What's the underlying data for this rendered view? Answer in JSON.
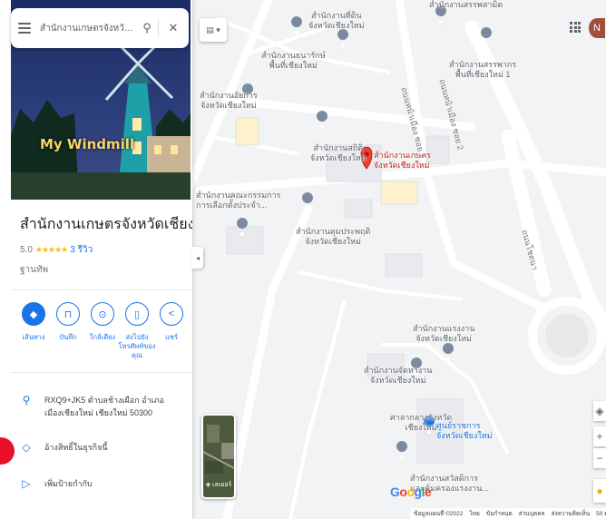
{
  "search": {
    "query": "สำนักงานเกษตรจังหวัดเชียงใหม่"
  },
  "photo": {
    "sign_text": "My Windmill"
  },
  "place": {
    "title": "สำนักงานเกษตรจังหวัดเชียงใหม่",
    "rating_value": "5.0",
    "stars": "★★★★★",
    "review_count": "3 รีวิว",
    "category": "ฐานทัพ"
  },
  "actions": [
    {
      "label": "เส้นทาง",
      "icon": "directions-icon"
    },
    {
      "label": "บันทึก",
      "icon": "bookmark-icon"
    },
    {
      "label": "ใกล้เคียง",
      "icon": "nearby-icon"
    },
    {
      "label": "ส่งไปยังโทรศัพท์ของคุณ",
      "icon": "send-to-phone-icon"
    },
    {
      "label": "แชร์",
      "icon": "share-icon"
    }
  ],
  "info": {
    "address": "RXQ9+JK5 ตำบลช้างเผือก อำเภอเมืองเชียงใหม่ เชียงใหม่ 50300",
    "claim": "อ้างสิทธิ์ในธุรกิจนี้",
    "add_label": "เพิ่มป้ายกำกับ"
  },
  "map": {
    "labels": {
      "top_center": "สำนักงานที่ดิน\nจังหวัดเชียงใหม่",
      "top_right": "สำนักงานสรรพากร\nพื้นที่เชียงใหม่ 1",
      "top_partial": "สำนักงานสรรพสามิต",
      "thanarak": "สำนักงานธนารักษ์\nพื้นที่เชียงใหม่",
      "yuttitham": "สำนักงานอัยการ\nจังหวัดเชียงใหม่",
      "sathiti": "สำนักงานสถิติ\nจังหวัดเชียงใหม่",
      "kaset": "สำนักงานเกษตร\nจังหวัดเชียงใหม่",
      "election": "สำนักงานคณะกรรมการ\nการเลือกตั้งประจำ...",
      "consumer": "สำนักงานคุมประพฤติ\nจังหวัดเชียงใหม่",
      "labor": "สำนักงานแรงงาน\nจังหวัดเชียงใหม่",
      "employment": "สำนักงานจัดหางาน\nจังหวัดเชียงใหม่",
      "court": "ศาลากลางจังหวัด\nเชียงใหม่",
      "damrongtham": "ศูนย์ราชการ\nจังหวัดเชียงใหม่",
      "welfare": "สำนักงานสวัสดิการ\nและคุ้มครองแรงงาน...",
      "road_a": "ถนนหน้าเมือง ซอย 1",
      "road_b": "ถนนหน้าเมือง ซอย 2",
      "road_c": "ถนนโชตนา"
    }
  },
  "map_controls": {
    "avatar_letter": "N",
    "satellite_label": "เลเยอร์"
  },
  "google_logo": [
    "G",
    "o",
    "o",
    "g",
    "l",
    "e"
  ],
  "footer": {
    "items": [
      "ข้อมูลแผนที่ ©2022",
      "ไทย",
      "ข้อกำหนด",
      "ส่วนบุคคล",
      "ส่งความคิดเห็น",
      "50 ม."
    ]
  },
  "colors": {
    "accent": "#1a73e8",
    "pin_red": "#ea4335",
    "star": "#fbbc04"
  }
}
